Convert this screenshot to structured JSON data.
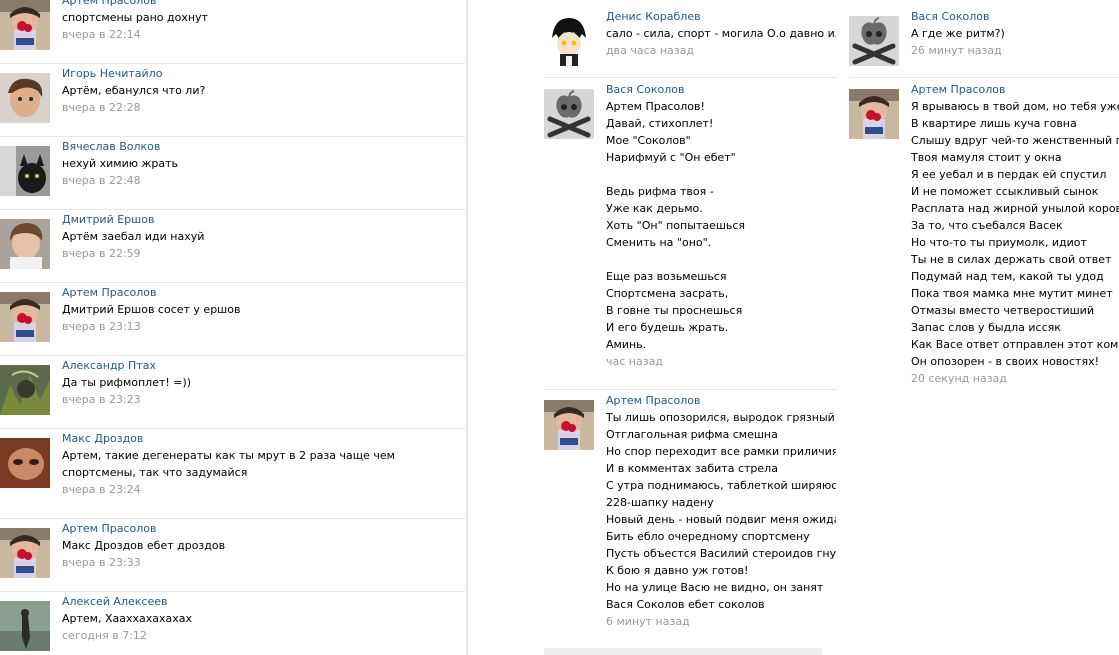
{
  "left_column": [
    {
      "author": "Артем Прасолов",
      "text": "спортсмены рано дохнут",
      "time": "вчера в 22:14",
      "avatar": "artem"
    },
    {
      "author": "Игорь Нечитайло",
      "text": "Артём, ебанулся что ли?",
      "time": "вчера в 22:28",
      "avatar": "igor"
    },
    {
      "author": "Вячеслав Волков",
      "text": "нехуй химию жрать",
      "time": "вчера в 22:48",
      "avatar": "vyacheslav"
    },
    {
      "author": "Дмитрий Ершов",
      "text": "Артём заебал иди нахуй",
      "time": "вчера в 22:59",
      "avatar": "dmitry"
    },
    {
      "author": "Артем Прасолов",
      "text": "Дмитрий Ершов сосет у ершов",
      "time": "вчера в 23:13",
      "avatar": "artem"
    },
    {
      "author": "Александр Птах",
      "text": "Да ты рифмоплет! =))",
      "time": "вчера в 23:23",
      "avatar": "alexandr"
    },
    {
      "author": "Макс Дроздов",
      "text": "Артем, такие дегенераты как ты мрут в 2 раза чаще чем спортсмены, так что задумайся",
      "time": "вчера в 23:24",
      "avatar": "max"
    },
    {
      "author": "Артем Прасолов",
      "text": "Макс Дроздов ебет дроздов",
      "time": "вчера в 23:33",
      "avatar": "artem"
    },
    {
      "author": "Алексей Алексеев",
      "text": "Артем, Хааххахахахах",
      "time": "сегодня в 7:12",
      "avatar": "aleksey"
    }
  ],
  "middle_column": [
    {
      "author": "Денис Кораблев",
      "text": "сало - сила, спорт - могила О.о давно известно",
      "time": "два часа назад",
      "avatar": "denis"
    },
    {
      "author": "Вася Соколов",
      "text": "Артем Прасолов!\nДавай, стихоплет!\nМое \"Соколов\"\nНарифмуй с \"Он ебет\"\n\nВедь рифма твоя -\nУже как дерьмо.\nХоть \"Он\" попытаешься\nСменить на \"оно\".\n\nЕще раз возьмешься\nСпортсмена засрать,\nВ говне ты проснешься\nИ его будешь жрать.\nАминь.",
      "time": "час назад",
      "avatar": "vasya"
    },
    {
      "author": "Артем Прасолов",
      "text": "Ты лишь опозорился, выродок грязный\nОтглагольная рифма смешна\nНо спор переходит все рамки приличия\nИ в комментах забита стрела\nС утра поднимаюсь, таблеткой ширяюсь\n228-шапку надену\nНовый день - новый подвиг меня ожидает\nБить ебло очередному спортсмену\nПусть объестся Василий стероидов гнусных\nК бою я давно уж готов!\nНо на улице Васю не видно, он занят\nВася Соколов ебет соколов",
      "time": "6 минут назад",
      "avatar": "artem"
    }
  ],
  "right_column": [
    {
      "author": "Вася Соколов",
      "text": "А где же ритм?)",
      "time": "26 минут назад",
      "avatar": "vasya"
    },
    {
      "author": "Артем Прасолов",
      "text": "Я врываюсь в твой дом, но тебя уже нет\nВ квартире лишь куча говна\nСлышу вдруг чей-то женственный голос\nТвоя мамуля стоит у окна\nЯ ее уебал и в пердак ей спустил\nИ не поможет ссыкливый сынок\nРасплата над жирной унылой коровой\nЗа то, что съебался Васек\nНо что-то ты приумолк, идиот\nТы не в силах держать свой ответ\nПодумай над тем, какой ты удод\nПока твоя мамка мне мутит минет\nОтмазы вместо четверостиший\nЗапас слов у быдла иссяк\nКак Васе ответ отправлен этот коммент\nОн опозорен - в своих новостях!",
      "time": "20 секунд назад",
      "avatar": "artem"
    }
  ]
}
